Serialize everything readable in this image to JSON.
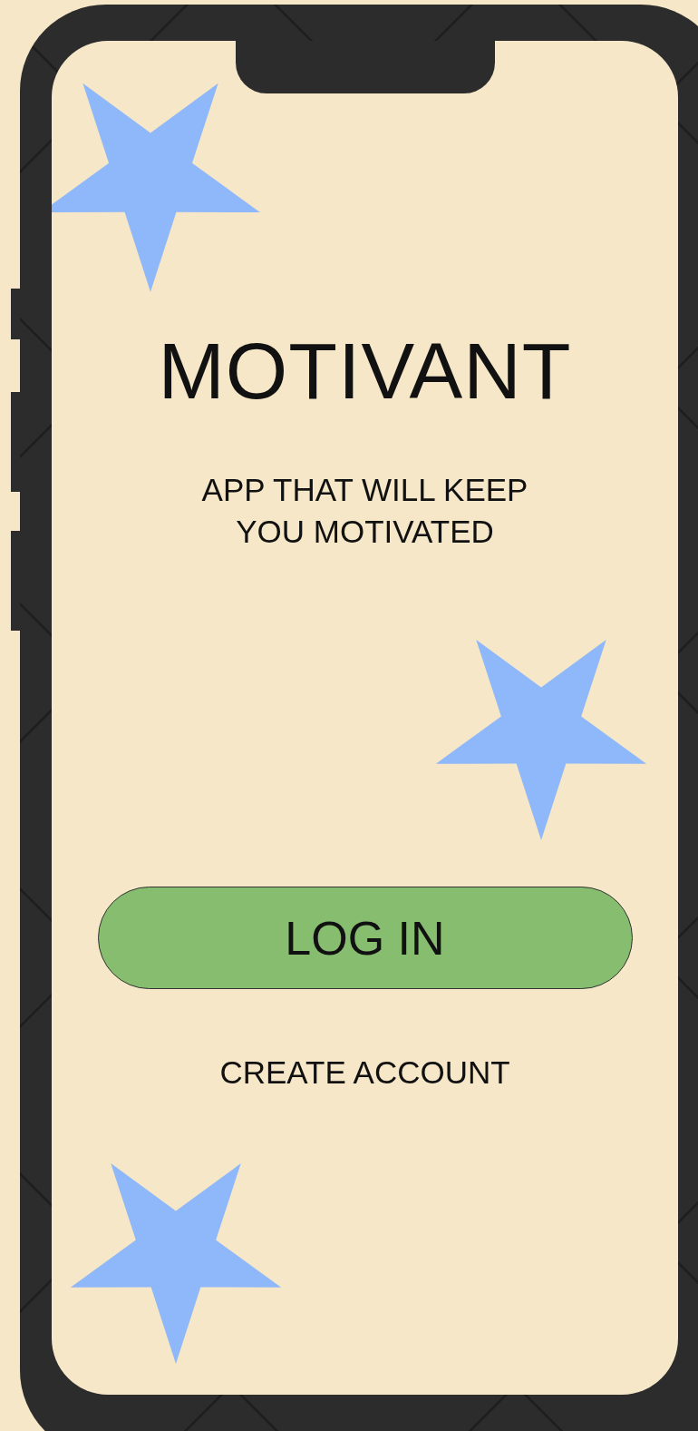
{
  "app": {
    "title": "MOTIVANT",
    "tagline": "APP THAT WILL KEEP YOU MOTIVATED"
  },
  "buttons": [
    {
      "label": "LOG IN",
      "kind": "primary"
    },
    {
      "label": "CREATE ACCOUNT",
      "kind": "link"
    }
  ]
}
